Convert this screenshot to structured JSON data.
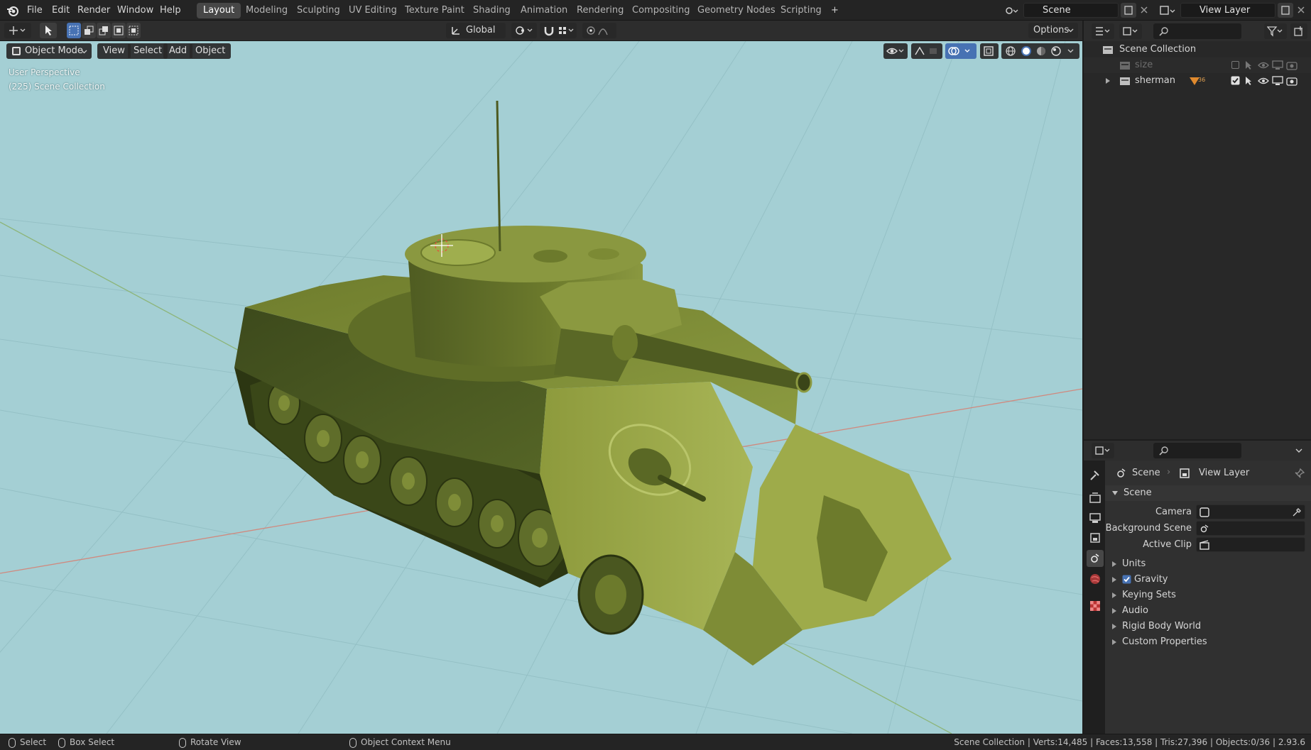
{
  "menu": {
    "items": [
      "File",
      "Edit",
      "Render",
      "Window",
      "Help"
    ]
  },
  "workspaces": {
    "tabs": [
      "Layout",
      "Modeling",
      "Sculpting",
      "UV Editing",
      "Texture Paint",
      "Shading",
      "Animation",
      "Rendering",
      "Compositing",
      "Geometry Nodes",
      "Scripting"
    ],
    "active": "Layout",
    "add_label": "+"
  },
  "scene_selector": {
    "value": "Scene"
  },
  "viewlayer_selector": {
    "value": "View Layer"
  },
  "viewport_header": {
    "transform_orientation": "Global",
    "options_label": "Options",
    "mode": "Object Mode",
    "view_label": "View",
    "select_label": "Select",
    "add_label": "Add",
    "object_label": "Object"
  },
  "viewport": {
    "perspective_label": "User Perspective",
    "collection_label": "(225) Scene Collection",
    "background_color": "#a4cfd4",
    "tank_color": "#7d8a3a"
  },
  "outliner": {
    "root": "Scene Collection",
    "items": [
      {
        "name": "size",
        "dimmed": true
      },
      {
        "name": "sherman",
        "dimmed": false,
        "badge": "36"
      }
    ]
  },
  "properties": {
    "breadcrumb_scene": "Scene",
    "breadcrumb_viewlayer": "View Layer",
    "section_title": "Scene",
    "fields": {
      "camera_label": "Camera",
      "background_scene_label": "Background Scene",
      "active_clip_label": "Active Clip"
    },
    "panels": [
      "Units",
      "Gravity",
      "Keying Sets",
      "Audio",
      "Rigid Body World",
      "Custom Properties"
    ],
    "gravity_checked": true
  },
  "statusbar": {
    "select": "Select",
    "box_select": "Box Select",
    "rotate_view": "Rotate View",
    "context_menu": "Object Context Menu",
    "stats": "Scene Collection | Verts:14,485 | Faces:13,558 | Tris:27,396 | Objects:0/36 | 2.93.6"
  },
  "colors": {
    "accent": "#4772b3",
    "active_tab": "#474747",
    "panel_bg": "#303030",
    "header_bg": "#2d2d2d"
  }
}
